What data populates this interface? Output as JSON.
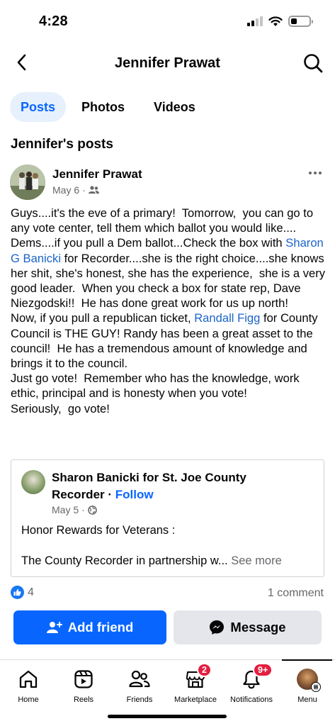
{
  "status_bar": {
    "time": "4:28"
  },
  "header": {
    "title": "Jennifer Prawat"
  },
  "tabs": [
    {
      "label": "Posts",
      "active": true
    },
    {
      "label": "Photos",
      "active": false
    },
    {
      "label": "Videos",
      "active": false
    }
  ],
  "section_title": "Jennifer's posts",
  "post": {
    "author": "Jennifer Prawat",
    "date": "May 6",
    "audience_icon": "friends-icon",
    "body": {
      "p1": "Guys....it's the eve of a primary!  Tomorrow,  you can go to any vote center, tell them which ballot you would like....",
      "p2_before": "Dems....if you pull a Dem ballot...Check the box with ",
      "mention1": "Sharon G Banicki",
      "p2_after": " for Recorder....she is the right choice....she knows her shit, she's honest, she has the experience,  she is a very good leader.  When you check a box for state rep, Dave Niezgodski!!  He has done great work for us up north!",
      "p3_before": "Now, if you pull a republican ticket, ",
      "mention2": "Randall Figg",
      "p3_after": " for County Council is THE GUY! Randy has been a great asset to the council!  He has a tremendous amount of knowledge and brings it to the council.",
      "p4": "Just go vote!  Remember who has the knowledge, work ethic, principal and is honesty when you vote!",
      "p5": "Seriously,  go vote!"
    },
    "shared": {
      "page_name": "Sharon Banicki for St. Joe County Recorder",
      "separator": "·",
      "follow_label": "Follow",
      "date": "May 5",
      "audience_icon": "globe-icon",
      "line1": "Honor Rewards for Veterans :",
      "line2": "The County Recorder in partnership w...",
      "see_more": "See more"
    },
    "likes": "4",
    "comments": "1 comment"
  },
  "actions": {
    "add_friend": "Add friend",
    "message": "Message"
  },
  "bottom_nav": {
    "home": "Home",
    "reels": "Reels",
    "friends": "Friends",
    "marketplace": "Marketplace",
    "marketplace_badge": "2",
    "notifications": "Notifications",
    "notifications_badge": "9+",
    "menu": "Menu"
  },
  "colors": {
    "accent": "#0866ff",
    "link": "#1c64c9",
    "badge": "#e41e3f",
    "secondary_text": "#65676b"
  }
}
